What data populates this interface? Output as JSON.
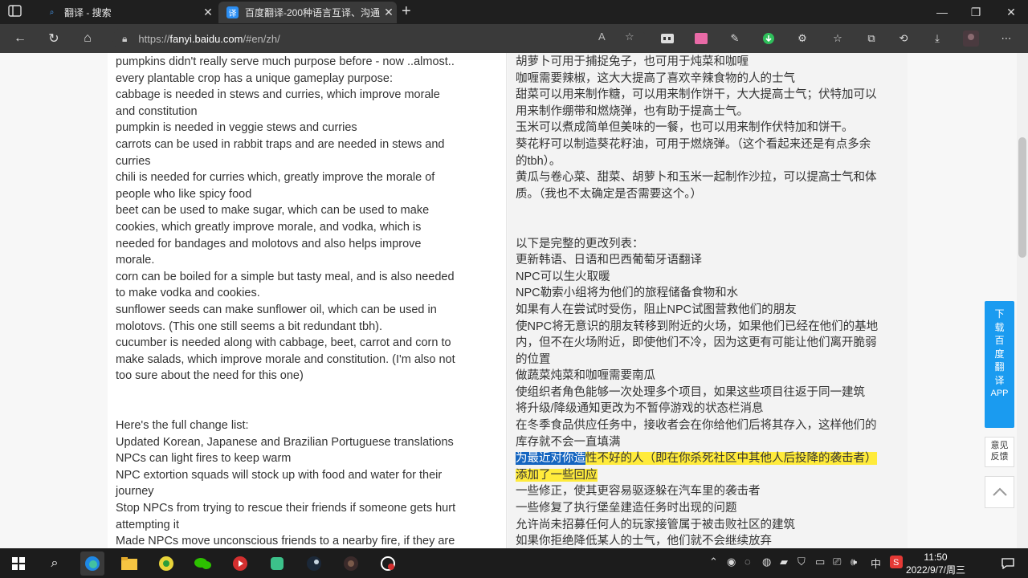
{
  "browser": {
    "tabs": [
      {
        "title": "翻译 - 搜索",
        "active": false
      },
      {
        "title": "百度翻译-200种语言互译、沟通",
        "active": true
      }
    ],
    "url_prefix": "https://",
    "url_domain": "fanyi.baidu.com",
    "url_path": "/#en/zh/"
  },
  "source_lines": [
    "pumpkins didn't really serve much purpose before - now ..almost..",
    "every plantable crop has a unique gameplay purpose:",
    "cabbage is needed in stews and curries, which improve morale",
    "and constitution",
    "pumpkin is needed in veggie stews and curries",
    "carrots can be used in rabbit traps and are needed in stews and",
    "curries",
    "chili is needed for curries which, greatly improve the morale of",
    "people who like spicy food",
    "beet can be used to make sugar, which can be used to make",
    "cookies, which greatly improve morale, and vodka, which is",
    "needed for bandages and molotovs and also helps improve",
    "morale.",
    "corn can be boiled for a simple but tasty meal, and is also needed",
    "to make vodka and cookies.",
    "sunflower seeds can make sunflower oil, which can be used in",
    "molotovs. (This one still seems a bit redundant tbh).",
    "cucumber is needed along with cabbage, beet, carrot and corn to",
    "make salads, which improve morale and constitution. (I'm also not",
    "too sure about the need for this one)",
    "",
    "",
    "Here's the full change list:",
    "Updated Korean, Japanese and Brazilian Portuguese translations",
    "NPCs can light fires to keep warm",
    "NPC extortion squads will stock up with food and water for their",
    "journey",
    "Stop NPCs from trying to rescue their friends if someone gets hurt",
    "attempting it",
    "Made NPCs move unconscious friends to a nearby fire, if they are"
  ],
  "target_lines": [
    "胡萝卜可用于捕捉兔子，也可用于炖菜和咖喱",
    "咖喱需要辣椒，这大大提高了喜欢辛辣食物的人的士气",
    "甜菜可以用来制作糖，可以用来制作饼干，大大提高士气；伏特加可以",
    "用来制作绷带和燃烧弹，也有助于提高士气。",
    "玉米可以煮成简单但美味的一餐，也可以用来制作伏特加和饼干。",
    "葵花籽可以制造葵花籽油，可用于燃烧弹。（这个看起来还是有点多余",
    "的tbh）。",
    "黄瓜与卷心菜、甜菜、胡萝卜和玉米一起制作沙拉，可以提高士气和体",
    "质。（我也不太确定是否需要这个。）",
    "",
    "",
    "以下是完整的更改列表：",
    "更新韩语、日语和巴西葡萄牙语翻译",
    "NPC可以生火取暖",
    "NPC勒索小组将为他们的旅程储备食物和水",
    "如果有人在尝试时受伤，阻止NPC试图营救他们的朋友",
    "使NPC将无意识的朋友转移到附近的火场，如果他们已经在他们的基地",
    "内，但不在火场附近，即使他们不冷，因为这更有可能让他们离开脆弱",
    "的位置",
    "做蔬菜炖菜和咖喱需要南瓜",
    "使组织者角色能够一次处理多个项目，如果这些项目往返于同一建筑",
    "将升级/降级通知更改为不暂停游戏的状态栏消息",
    "在冬季食品供应任务中，接收者会在你给他们后将其存入，这样他们的",
    "库存就不会一直填满"
  ],
  "highlight": {
    "selected": "为最近对你造",
    "rest": "性不好的人（即在你杀死社区中其他人后投降的袭击者）",
    "line2": "添加了一些回应"
  },
  "target_after": [
    "一些修正，使其更容易驱逐躲在汽车里的袭击者",
    "一些修复了执行堡垒建造任务时出现的问题",
    "允许尚未招募任何人的玩家接管属于被击败社区的建筑",
    "如果你拒绝降低某人的士气，他们就不会继续放弃"
  ],
  "side": {
    "download": [
      "下",
      "载",
      "百",
      "度",
      "翻",
      "译",
      "APP"
    ],
    "feedback": [
      "意见",
      "反馈"
    ]
  },
  "clock": {
    "time": "11:50",
    "date": "2022/9/7/周三"
  },
  "tray": {
    "ime": "中"
  }
}
